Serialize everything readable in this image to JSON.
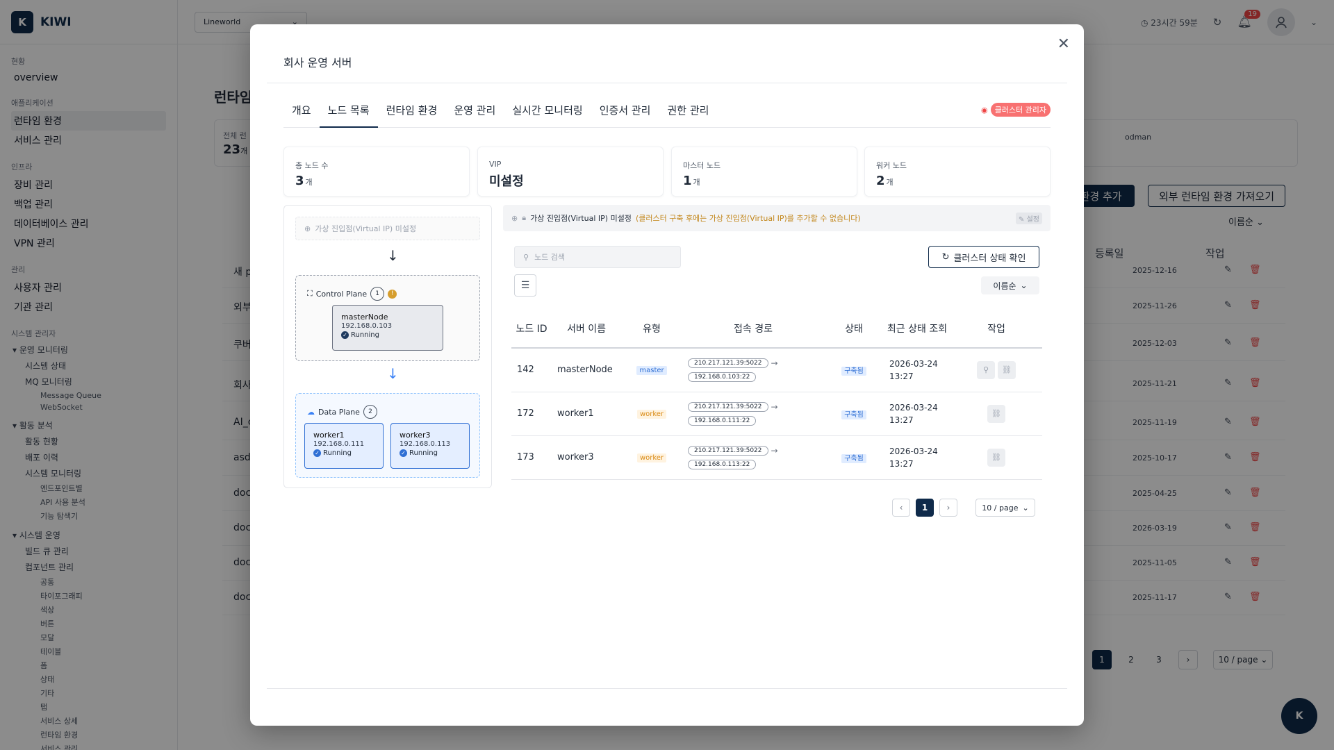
{
  "app": {
    "logo_letter": "K",
    "name": "KIWI"
  },
  "topbar": {
    "workspace": "Lineworld",
    "session": "23시간 59분",
    "notifications": "19"
  },
  "sidebar": {
    "sections": [
      {
        "title": "현황",
        "items": [
          "overview"
        ]
      },
      {
        "title": "애플리케이션",
        "items": [
          "런타임 환경",
          "서비스 관리"
        ]
      },
      {
        "title": "인프라",
        "items": [
          "장비 관리",
          "백업 관리",
          "데이터베이스 관리",
          "VPN 관리"
        ]
      },
      {
        "title": "관리",
        "items": [
          "사용자 관리",
          "기관 관리"
        ]
      }
    ],
    "sysadmin_title": "시스템 관리자",
    "ops_monitor": {
      "label": "운영 모니터링",
      "subs": [
        "시스템 상태",
        "MQ 모니터링"
      ],
      "mq": [
        "Message Queue",
        "WebSocket"
      ]
    },
    "activity": {
      "label": "활동 분석",
      "subs": [
        "활동 현황",
        "배포 이력",
        "시스템 모니터링"
      ],
      "sysmon": [
        "엔드포인트별",
        "API 사용 분석",
        "기능 탐색기"
      ]
    },
    "sysops": {
      "label": "시스템 운영",
      "subs": [
        "빌드 큐 관리",
        "컴포넌트 관리"
      ],
      "components": [
        "공통",
        "타이포그래피",
        "색상",
        "버튼",
        "모달",
        "테이블",
        "폼",
        "상태",
        "기타",
        "탭",
        "서비스 상세",
        "런타임 환경",
        "서비스 관리"
      ]
    }
  },
  "background": {
    "page_title": "런타임",
    "card_label": "전체 런",
    "card_value": "23",
    "card_unit": "개",
    "card_right": "odman",
    "add_btn": "I 환경 추가",
    "import_btn": "외부 런타임 환경 가져오기",
    "sort": "이름순",
    "headers": {
      "date": "등록일",
      "action": "작업"
    },
    "rows": [
      {
        "name": "새 p",
        "date": "2025-12-16"
      },
      {
        "name": "외부",
        "date": "2025-11-26"
      },
      {
        "name": "쿠버",
        "date": "2025-12-03"
      },
      {
        "name": "회사",
        "date": "2025-11-21"
      },
      {
        "name": "AI_c",
        "date": "2025-11-19"
      },
      {
        "name": "asd",
        "date": "2025-10-17"
      },
      {
        "name": "doc",
        "date": "2025-04-25"
      },
      {
        "name": "doc",
        "date": "2026-03-19"
      },
      {
        "name": "doc",
        "date": "2025-11-05"
      },
      {
        "name": "doc",
        "date": "2025-11-17"
      }
    ],
    "pages": [
      "1",
      "2",
      "3"
    ],
    "per_page": "10 / page",
    "fab": "K"
  },
  "modal": {
    "title": "회사 운영 서버",
    "tabs": [
      "개요",
      "노드 목록",
      "런타임 환경",
      "운영 관리",
      "실시간 모니터링",
      "인증서 관리",
      "권한 관리"
    ],
    "cluster_admin": "클러스터 관리자",
    "stats": [
      {
        "label": "총 노드 수",
        "value": "3",
        "unit": "개"
      },
      {
        "label": "VIP",
        "value": "미설정",
        "unit": ""
      },
      {
        "label": "마스터 노드",
        "value": "1",
        "unit": "개"
      },
      {
        "label": "워커 노드",
        "value": "2",
        "unit": "개"
      }
    ],
    "topology": {
      "vip_placeholder": "가상 진입점(Virtual IP) 미설정",
      "control_plane": {
        "label": "Control Plane",
        "count": "1"
      },
      "data_plane": {
        "label": "Data Plane",
        "count": "2"
      },
      "master": {
        "name": "masterNode",
        "ip": "192.168.0.103",
        "status": "Running"
      },
      "workers": [
        {
          "name": "worker1",
          "ip": "192.168.0.111",
          "status": "Running"
        },
        {
          "name": "worker3",
          "ip": "192.168.0.113",
          "status": "Running"
        }
      ]
    },
    "vip_notice": {
      "text": "가상 진입점(Virtual IP) 미설정",
      "note": "(클러스터 구축 후에는 가상 진입점(Virtual IP)를 추가할 수 없습니다)",
      "setting": "설정"
    },
    "search_placeholder": "노드 검색",
    "check_btn": "클러스터 상태 확인",
    "sort": "이름순",
    "table": {
      "headers": [
        "노드 ID",
        "서버 이름",
        "유형",
        "접속 경로",
        "상태",
        "최근 상태 조회",
        "작업"
      ],
      "rows": [
        {
          "id": "142",
          "name": "masterNode",
          "type": "master",
          "addr1": "210.217.121.39:5022",
          "addr2": "192.168.0.103:22",
          "status": "구축됨",
          "date": "2026-03-24",
          "time": "13:27"
        },
        {
          "id": "172",
          "name": "worker1",
          "type": "worker",
          "addr1": "210.217.121.39:5022",
          "addr2": "192.168.0.111:22",
          "status": "구축됨",
          "date": "2026-03-24",
          "time": "13:27"
        },
        {
          "id": "173",
          "name": "worker3",
          "type": "worker",
          "addr1": "210.217.121.39:5022",
          "addr2": "192.168.0.113:22",
          "status": "구축됨",
          "date": "2026-03-24",
          "time": "13:27"
        }
      ]
    },
    "pagination": {
      "current": "1",
      "per_page": "10 / page"
    }
  },
  "colors": {
    "primary": "#0f2a4a",
    "danger": "#ef4444",
    "master": "#2f6fd4",
    "worker": "#d98a14"
  }
}
